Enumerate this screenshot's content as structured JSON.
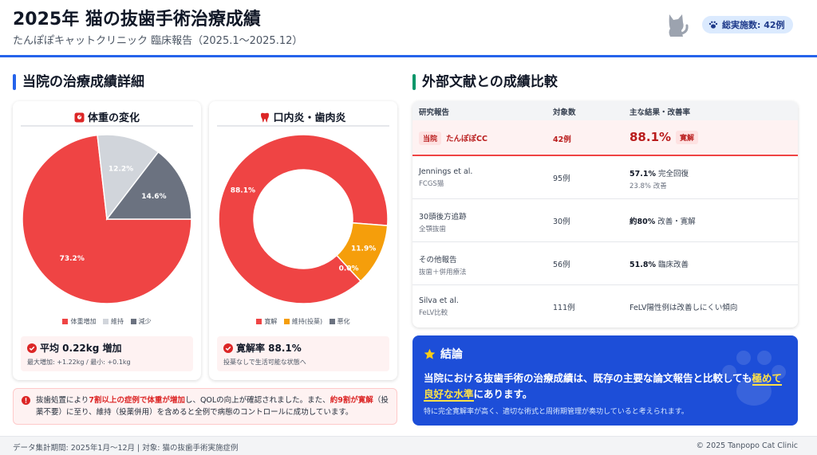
{
  "header": {
    "title": "2025年 猫の抜歯手術治療成績",
    "subtitle": "たんぽぽキャットクリニック 臨床報告（2025.1〜2025.12）",
    "badge": "総実施数: 42例"
  },
  "left_section": {
    "title": "当院の治療成績詳細"
  },
  "right_section": {
    "title": "外部文献との成績比較"
  },
  "weight_card": {
    "title": "体重の変化",
    "legend": [
      "体重増加",
      "維持",
      "減少"
    ],
    "stat_main": "平均 0.22kg 増加",
    "stat_sub": "最大増加: +1.22kg / 最小: +0.1kg"
  },
  "stoma_card": {
    "title": "口内炎・歯肉炎",
    "legend": [
      "寛解",
      "維持(投薬)",
      "悪化"
    ],
    "stat_main": "寛解率 88.1%",
    "stat_sub": "投薬なしで生活可能な状態へ"
  },
  "chart_data": [
    {
      "type": "pie",
      "title": "体重の変化",
      "categories": [
        "体重増加",
        "維持",
        "減少"
      ],
      "values": [
        73.2,
        12.2,
        14.6
      ],
      "colors": [
        "#ef4444",
        "#d1d5db",
        "#6b7280"
      ],
      "labels": [
        "73.2%",
        "12.2%",
        "14.6%"
      ],
      "legend_position": "bottom"
    },
    {
      "type": "pie",
      "title": "口内炎・歯肉炎",
      "categories": [
        "寛解",
        "維持(投薬)",
        "悪化"
      ],
      "values": [
        88.1,
        11.9,
        0.0
      ],
      "colors": [
        "#ef4444",
        "#f59e0b",
        "#6b7280"
      ],
      "labels": [
        "88.1%",
        "11.9%",
        "0.0%"
      ],
      "donut": true,
      "legend_position": "bottom"
    }
  ],
  "alert": {
    "p1": "抜歯処置により",
    "h1": "7割以上の症例で体重が増加",
    "p2": "し、QOLの向上が確認されました。また、",
    "h2": "約9割が寛解",
    "p3": "（投薬不要）に至り、維持（投薬併用）を含めると全例で病態のコントロールに成功しています。"
  },
  "table": {
    "headers": [
      "研究報告",
      "対象数",
      "主な結果・改善率"
    ],
    "ours": {
      "tag": "当院",
      "name": "たんぽぽCC",
      "n": "42例",
      "rate": "88.1%",
      "rate_tag": "寛解"
    },
    "rows": [
      {
        "name": "Jennings et al.",
        "sub": "FCGS猫",
        "n": "95例",
        "r_b": "57.1%",
        "r_t": " 完全回復",
        "r_sub": "23.8% 改善"
      },
      {
        "name": "30頭後方追跡",
        "sub": "全顎抜歯",
        "n": "30例",
        "r_b": "約80%",
        "r_t": " 改善・寛解",
        "r_sub": ""
      },
      {
        "name": "その他報告",
        "sub": "抜歯＋併用療法",
        "n": "56例",
        "r_b": "51.8%",
        "r_t": " 臨床改善",
        "r_sub": ""
      },
      {
        "name": "Silva et al.",
        "sub": "FeLV比較",
        "n": "111例",
        "r_b": "",
        "r_t": "FeLV陽性例は改善しにくい傾向",
        "r_sub": ""
      }
    ]
  },
  "conclusion": {
    "title": "結論",
    "main_a": "当院における抜歯手術の治療成績は、既存の主要な論文報告と比較しても",
    "main_em": "極めて良好な水準",
    "main_b": "にあります。",
    "sub": "特に完全寛解率が高く、適切な術式と周術期管理が奏功していると考えられます。"
  },
  "footer": {
    "left": "データ集計期間: 2025年1月〜12月 | 対象: 猫の抜歯手術実施症例",
    "right": "© 2025 Tanpopo Cat Clinic"
  },
  "colors": {
    "accent": "#2563eb",
    "red": "#ef4444",
    "green": "#059669",
    "conclusion_bg": "#1d4ed8"
  },
  "icons": [
    "cat-icon",
    "paw-icon",
    "scale-icon",
    "tooth-icon",
    "check-circle-icon",
    "alert-icon",
    "star-icon"
  ]
}
